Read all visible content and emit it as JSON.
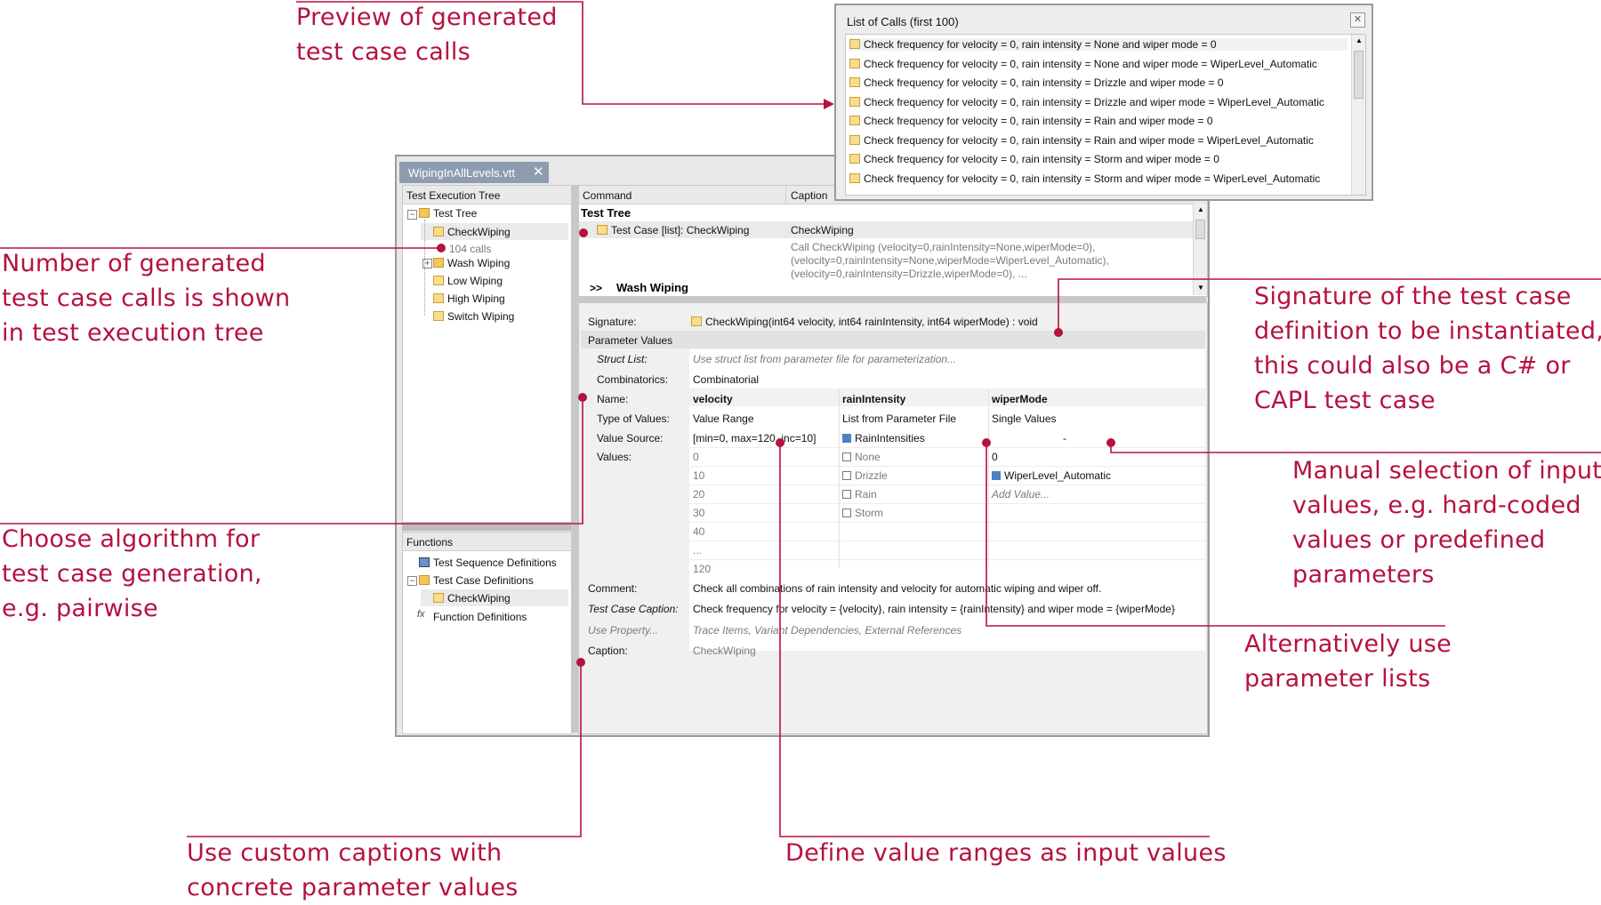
{
  "annotations": {
    "preview": [
      "Preview of generated",
      "test case calls"
    ],
    "number": [
      "Number of generated",
      "test case calls is shown",
      "in test execution tree"
    ],
    "signature": [
      "Signature of the test case",
      "definition to be instantiated,",
      "this could also be a C# or",
      "CAPL test case"
    ],
    "manual": [
      "Manual selection of input",
      "values, e.g. hard-coded",
      "values or predefined",
      "parameters"
    ],
    "algorithm": [
      "Choose algorithm for",
      "test case generation,",
      "e.g. pairwise"
    ],
    "paramlists": [
      "Alternatively use",
      "parameter lists"
    ],
    "captions": [
      "Use custom captions with",
      "concrete parameter values"
    ],
    "ranges": [
      "Define value ranges as input values"
    ]
  },
  "colors": {
    "accent": "#b5123e"
  },
  "calls_popup": {
    "title": "List of Calls (first 100)",
    "items": [
      "Check frequency for velocity = 0, rain intensity = None and wiper mode = 0",
      "Check frequency for velocity = 0, rain intensity = None and wiper mode = WiperLevel_Automatic",
      "Check frequency for velocity = 0, rain intensity = Drizzle and wiper mode = 0",
      "Check frequency for velocity = 0, rain intensity = Drizzle and wiper mode = WiperLevel_Automatic",
      "Check frequency for velocity = 0, rain intensity = Rain and wiper mode = 0",
      "Check frequency for velocity = 0, rain intensity = Rain and wiper mode = WiperLevel_Automatic",
      "Check frequency for velocity = 0, rain intensity = Storm and wiper mode = 0",
      "Check frequency for velocity = 0, rain intensity = Storm and wiper mode = WiperLevel_Automatic"
    ]
  },
  "editor": {
    "tab": "WipingInAllLevels.vtt",
    "tree_header": "Test Execution Tree",
    "tree": {
      "root": "Test Tree",
      "checkwiping": "CheckWiping",
      "calls": "104 calls",
      "wash": "Wash Wiping",
      "low": "Low Wiping",
      "high": "High Wiping",
      "switch": "Switch Wiping"
    },
    "functions_header": "Functions",
    "functions": {
      "seq": "Test Sequence Definitions",
      "tcdefs": "Test Case Definitions",
      "checkwiping": "CheckWiping",
      "funcdefs": "Function Definitions"
    },
    "cmd_header": {
      "command": "Command",
      "caption": "Caption"
    },
    "cmd": {
      "test_tree": "Test Tree",
      "test_case": "Test Case [list]: CheckWiping",
      "test_case_caption": "CheckWiping",
      "call_lines": [
        "Call CheckWiping (velocity=0,rainIntensity=None,wiperMode=0),",
        "(velocity=0,rainIntensity=None,wiperMode=WiperLevel_Automatic),",
        "(velocity=0,rainIntensity=Drizzle,wiperMode=0), ..."
      ],
      "wash_prefix": ">>",
      "wash": "Wash Wiping"
    },
    "props": {
      "signature_label": "Signature:",
      "signature": "CheckWiping(int64 velocity, int64 rainIntensity, int64 wiperMode) : void",
      "param_values": "Parameter Values",
      "struct_label": "Struct List:",
      "struct_placeholder": "Use struct list from parameter file for parameterization...",
      "comb_label": "Combinatorics:",
      "comb_value": "Combinatorial",
      "name_label": "Name:",
      "names": [
        "velocity",
        "rainIntensity",
        "wiperMode"
      ],
      "type_label": "Type of Values:",
      "types": [
        "Value Range",
        "List from Parameter File",
        "Single Values"
      ],
      "source_label": "Value Source:",
      "sources": [
        "[min=0, max=120, inc=10]",
        "RainIntensities",
        "-"
      ],
      "values_label": "Values:",
      "velocity_values": [
        "0",
        "10",
        "20",
        "30",
        "40",
        "...",
        "120"
      ],
      "rain_values": [
        "None",
        "Drizzle",
        "Rain",
        "Storm"
      ],
      "wiper_values": [
        "0",
        "WiperLevel_Automatic"
      ],
      "add_value": "Add Value...",
      "comment_label": "Comment:",
      "comment": "Check all combinations of rain intensity and velocity for automatic wiping and wiper off.",
      "tc_caption_label": "Test Case Caption:",
      "tc_caption": "Check frequency for velocity = {velocity}, rain intensity = {rainIntensity} and wiper mode = {wiperMode}",
      "use_prop_label": "Use Property...",
      "use_prop": "Trace Items, Variant Dependencies, External References",
      "caption_label": "Caption:",
      "caption": "CheckWiping"
    }
  }
}
